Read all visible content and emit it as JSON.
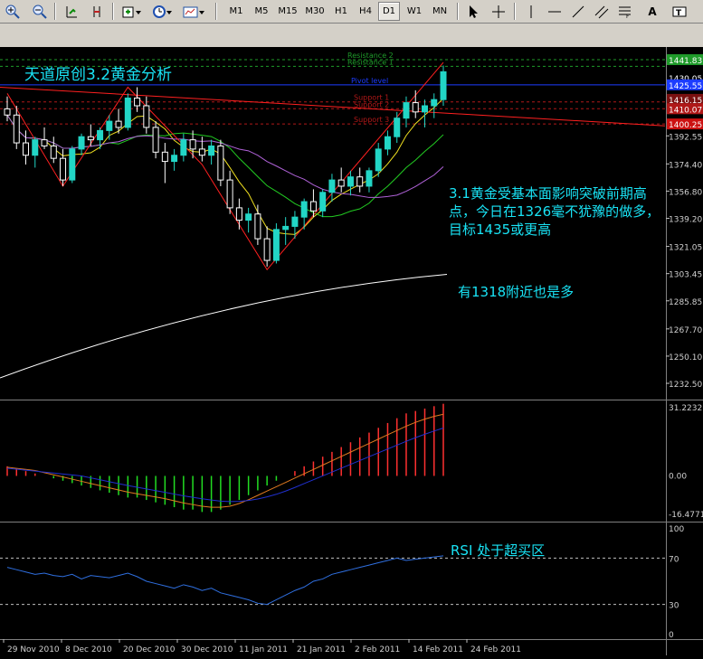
{
  "toolbar": {
    "timeframes": [
      "M1",
      "M5",
      "M15",
      "M30",
      "H1",
      "H4",
      "D1",
      "W1",
      "MN"
    ],
    "active_timeframe": "D1",
    "text_tool": "A"
  },
  "annotations": {
    "title": "天道原创3.2黄金分析",
    "note_main": "3.1黄金受基本面影响突破前期高点，今日在1326毫不犹豫的做多，目标1435或更高",
    "note_sub": "有1318附近也是多",
    "note_rsi": "RSI 处于超买区"
  },
  "levels": {
    "resistance2": "Resistance 2",
    "resistance1": "Resistance 1",
    "pivot": "Pivot level",
    "support1": "Support 1",
    "support2": "Support 2",
    "support3": "Support 3"
  },
  "price_axis": {
    "ticks": [
      "1392.55",
      "1374.40",
      "1356.80",
      "1339.20",
      "1321.05",
      "1303.45",
      "1285.85",
      "1267.70",
      "1250.10",
      "1232.50"
    ],
    "badges": [
      {
        "label": "1441.83",
        "value": 1441.83,
        "color": "#1f9b2a"
      },
      {
        "label": "1430.05",
        "value": 1430.05,
        "color": "#000000"
      },
      {
        "label": "1425.55",
        "value": 1425.55,
        "color": "#1c3cff"
      },
      {
        "label": "1416.15",
        "value": 1416.15,
        "color": "#7a1010"
      },
      {
        "label": "1410.07",
        "value": 1410.07,
        "color": "#b01818"
      },
      {
        "label": "1400.25",
        "value": 1400.25,
        "color": "#cc1111"
      }
    ]
  },
  "macd_axis": {
    "top": "31.2232",
    "zero": "0.00",
    "bottom": "-16.4771"
  },
  "rsi_axis": {
    "ticks": [
      "100",
      "70",
      "30",
      "0"
    ]
  },
  "time_axis": {
    "labels": [
      "29 Nov 2010",
      "8 Dec 2010",
      "20 Dec 2010",
      "30 Dec 2010",
      "11 Jan 2011",
      "21 Jan 2011",
      "2 Feb 2011",
      "14 Feb 2011",
      "24 Feb 2011"
    ]
  },
  "colors": {
    "background": "#000000",
    "bull": "#22d6c6",
    "bear": "#ffffff",
    "ma_fast": "#f0e020",
    "ma_mid": "#22cc22",
    "ma_slow": "#b062d8",
    "ma_long": "#ffffff",
    "trendline": "#ff2020",
    "annotation": "#19e3f5"
  },
  "chart_data": {
    "type": "candlestick",
    "series": [
      {
        "name": "candles",
        "ohlc": [
          [
            1410,
            1418,
            1402,
            1406
          ],
          [
            1406,
            1412,
            1384,
            1388
          ],
          [
            1388,
            1396,
            1374,
            1380
          ],
          [
            1380,
            1392,
            1372,
            1390
          ],
          [
            1390,
            1398,
            1384,
            1386
          ],
          [
            1386,
            1392,
            1375,
            1378
          ],
          [
            1378,
            1384,
            1360,
            1364
          ],
          [
            1364,
            1386,
            1362,
            1384
          ],
          [
            1384,
            1394,
            1380,
            1392
          ],
          [
            1392,
            1400,
            1386,
            1390
          ],
          [
            1390,
            1398,
            1384,
            1396
          ],
          [
            1396,
            1406,
            1390,
            1402
          ],
          [
            1402,
            1410,
            1394,
            1398
          ],
          [
            1398,
            1420,
            1396,
            1417
          ],
          [
            1417,
            1424,
            1408,
            1412
          ],
          [
            1412,
            1418,
            1394,
            1398
          ],
          [
            1398,
            1402,
            1378,
            1382
          ],
          [
            1382,
            1388,
            1362,
            1376
          ],
          [
            1376,
            1384,
            1370,
            1380
          ],
          [
            1380,
            1394,
            1376,
            1390
          ],
          [
            1390,
            1396,
            1378,
            1384
          ],
          [
            1384,
            1392,
            1376,
            1380
          ],
          [
            1380,
            1390,
            1374,
            1386
          ],
          [
            1386,
            1390,
            1360,
            1364
          ],
          [
            1364,
            1370,
            1342,
            1346
          ],
          [
            1346,
            1352,
            1332,
            1338
          ],
          [
            1338,
            1346,
            1330,
            1342
          ],
          [
            1342,
            1348,
            1322,
            1326
          ],
          [
            1326,
            1334,
            1308,
            1312
          ],
          [
            1312,
            1336,
            1310,
            1332
          ],
          [
            1332,
            1340,
            1322,
            1334
          ],
          [
            1334,
            1344,
            1326,
            1340
          ],
          [
            1340,
            1352,
            1332,
            1350
          ],
          [
            1350,
            1358,
            1340,
            1344
          ],
          [
            1344,
            1358,
            1340,
            1356
          ],
          [
            1356,
            1368,
            1350,
            1364
          ],
          [
            1364,
            1372,
            1356,
            1360
          ],
          [
            1360,
            1370,
            1354,
            1366
          ],
          [
            1366,
            1372,
            1356,
            1360
          ],
          [
            1360,
            1372,
            1356,
            1370
          ],
          [
            1370,
            1388,
            1366,
            1384
          ],
          [
            1384,
            1396,
            1380,
            1392
          ],
          [
            1392,
            1408,
            1388,
            1404
          ],
          [
            1404,
            1418,
            1398,
            1414
          ],
          [
            1414,
            1422,
            1404,
            1408
          ],
          [
            1408,
            1416,
            1398,
            1412
          ],
          [
            1412,
            1420,
            1404,
            1416
          ],
          [
            1416,
            1438,
            1412,
            1434
          ]
        ]
      }
    ],
    "macd_hist": [
      4,
      3,
      2,
      1,
      0,
      -1,
      -2,
      -3,
      -4,
      -5,
      -6,
      -7,
      -8,
      -9,
      -9,
      -10,
      -11,
      -12,
      -13,
      -14,
      -14,
      -15,
      -15,
      -14,
      -12,
      -10,
      -8,
      -6,
      -4,
      -2,
      0,
      2,
      4,
      6,
      8,
      10,
      12,
      14,
      16,
      18,
      20,
      22,
      24,
      26,
      27,
      28,
      29,
      30
    ],
    "rsi": [
      62,
      60,
      58,
      56,
      57,
      55,
      54,
      56,
      52,
      55,
      54,
      53,
      55,
      57,
      54,
      50,
      48,
      46,
      44,
      47,
      45,
      42,
      44,
      40,
      38,
      36,
      34,
      31,
      30,
      34,
      38,
      42,
      45,
      50,
      52,
      56,
      58,
      60,
      62,
      64,
      66,
      68,
      70,
      68,
      69,
      70,
      71,
      72
    ]
  }
}
